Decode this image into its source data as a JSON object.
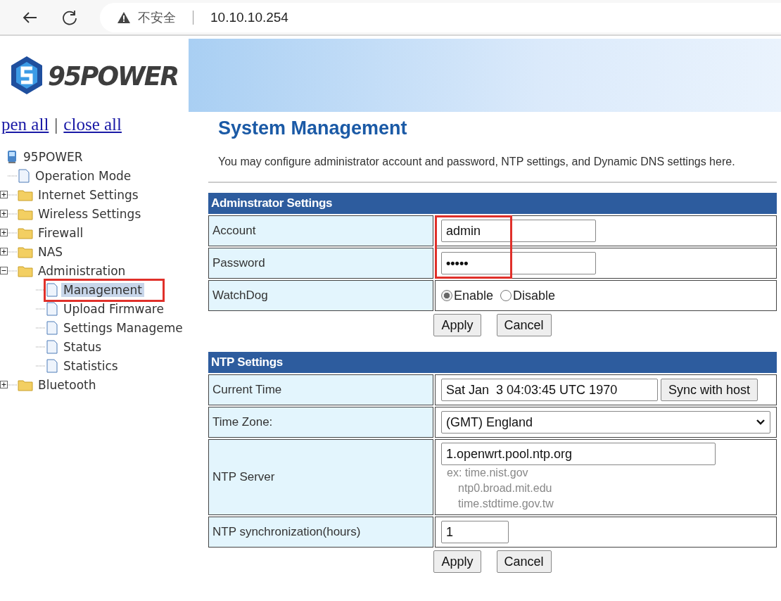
{
  "browser": {
    "security_label": "不安全",
    "address": "10.10.10.254"
  },
  "logo": {
    "text": "95POWER"
  },
  "sidebar": {
    "links": [
      {
        "label": "pen all"
      },
      {
        "label": "close all"
      }
    ],
    "separator": "|",
    "tree": [
      {
        "kind": "root",
        "label": "95POWER",
        "children": [
          {
            "kind": "page",
            "label": "Operation Mode",
            "selected": false
          },
          {
            "kind": "folder",
            "label": "Internet Settings",
            "expanded": false
          },
          {
            "kind": "folder",
            "label": "Wireless Settings",
            "expanded": false
          },
          {
            "kind": "folder",
            "label": "Firewall",
            "expanded": false
          },
          {
            "kind": "folder",
            "label": "NAS",
            "expanded": false
          },
          {
            "kind": "folder",
            "label": "Administration",
            "expanded": true,
            "children": [
              {
                "kind": "page",
                "label": "Management",
                "selected": true
              },
              {
                "kind": "page",
                "label": "Upload Firmware",
                "selected": false
              },
              {
                "kind": "page",
                "label": "Settings Manageme",
                "selected": false
              },
              {
                "kind": "page",
                "label": "Status",
                "selected": false
              },
              {
                "kind": "page",
                "label": "Statistics",
                "selected": false
              }
            ]
          },
          {
            "kind": "folder",
            "label": "Bluetooth",
            "expanded": false
          }
        ]
      }
    ]
  },
  "page": {
    "title": "System Management",
    "description": "You may configure administrator account and password, NTP settings, and Dynamic DNS settings here."
  },
  "sections": [
    {
      "title": "Adminstrator Settings",
      "highlight_fields": true,
      "rows": [
        {
          "kind": "input",
          "label": "Account",
          "value": "admin"
        },
        {
          "kind": "input",
          "label": "Password",
          "value": "•••••",
          "bold": true
        },
        {
          "kind": "radio",
          "label": "WatchDog",
          "options": [
            {
              "label": "Enable",
              "selected": true
            },
            {
              "label": "Disable",
              "selected": false
            }
          ]
        }
      ],
      "buttons": [
        "Apply",
        "Cancel"
      ]
    },
    {
      "title": "NTP Settings",
      "rows": [
        {
          "kind": "time",
          "label": "Current Time",
          "value": "Sat Jan  3 04:03:45 UTC 1970",
          "button": "Sync with host"
        },
        {
          "kind": "select",
          "label": "Time Zone:",
          "value": "(GMT) England"
        },
        {
          "kind": "server",
          "label": "NTP Server",
          "value": "1.openwrt.pool.ntp.org",
          "hints": [
            "ex: time.nist.gov",
            "ntp0.broad.mit.edu",
            "time.stdtime.gov.tw"
          ]
        },
        {
          "kind": "short",
          "label": "NTP synchronization(hours)",
          "value": "1"
        }
      ],
      "buttons": [
        "Apply",
        "Cancel"
      ]
    }
  ]
}
